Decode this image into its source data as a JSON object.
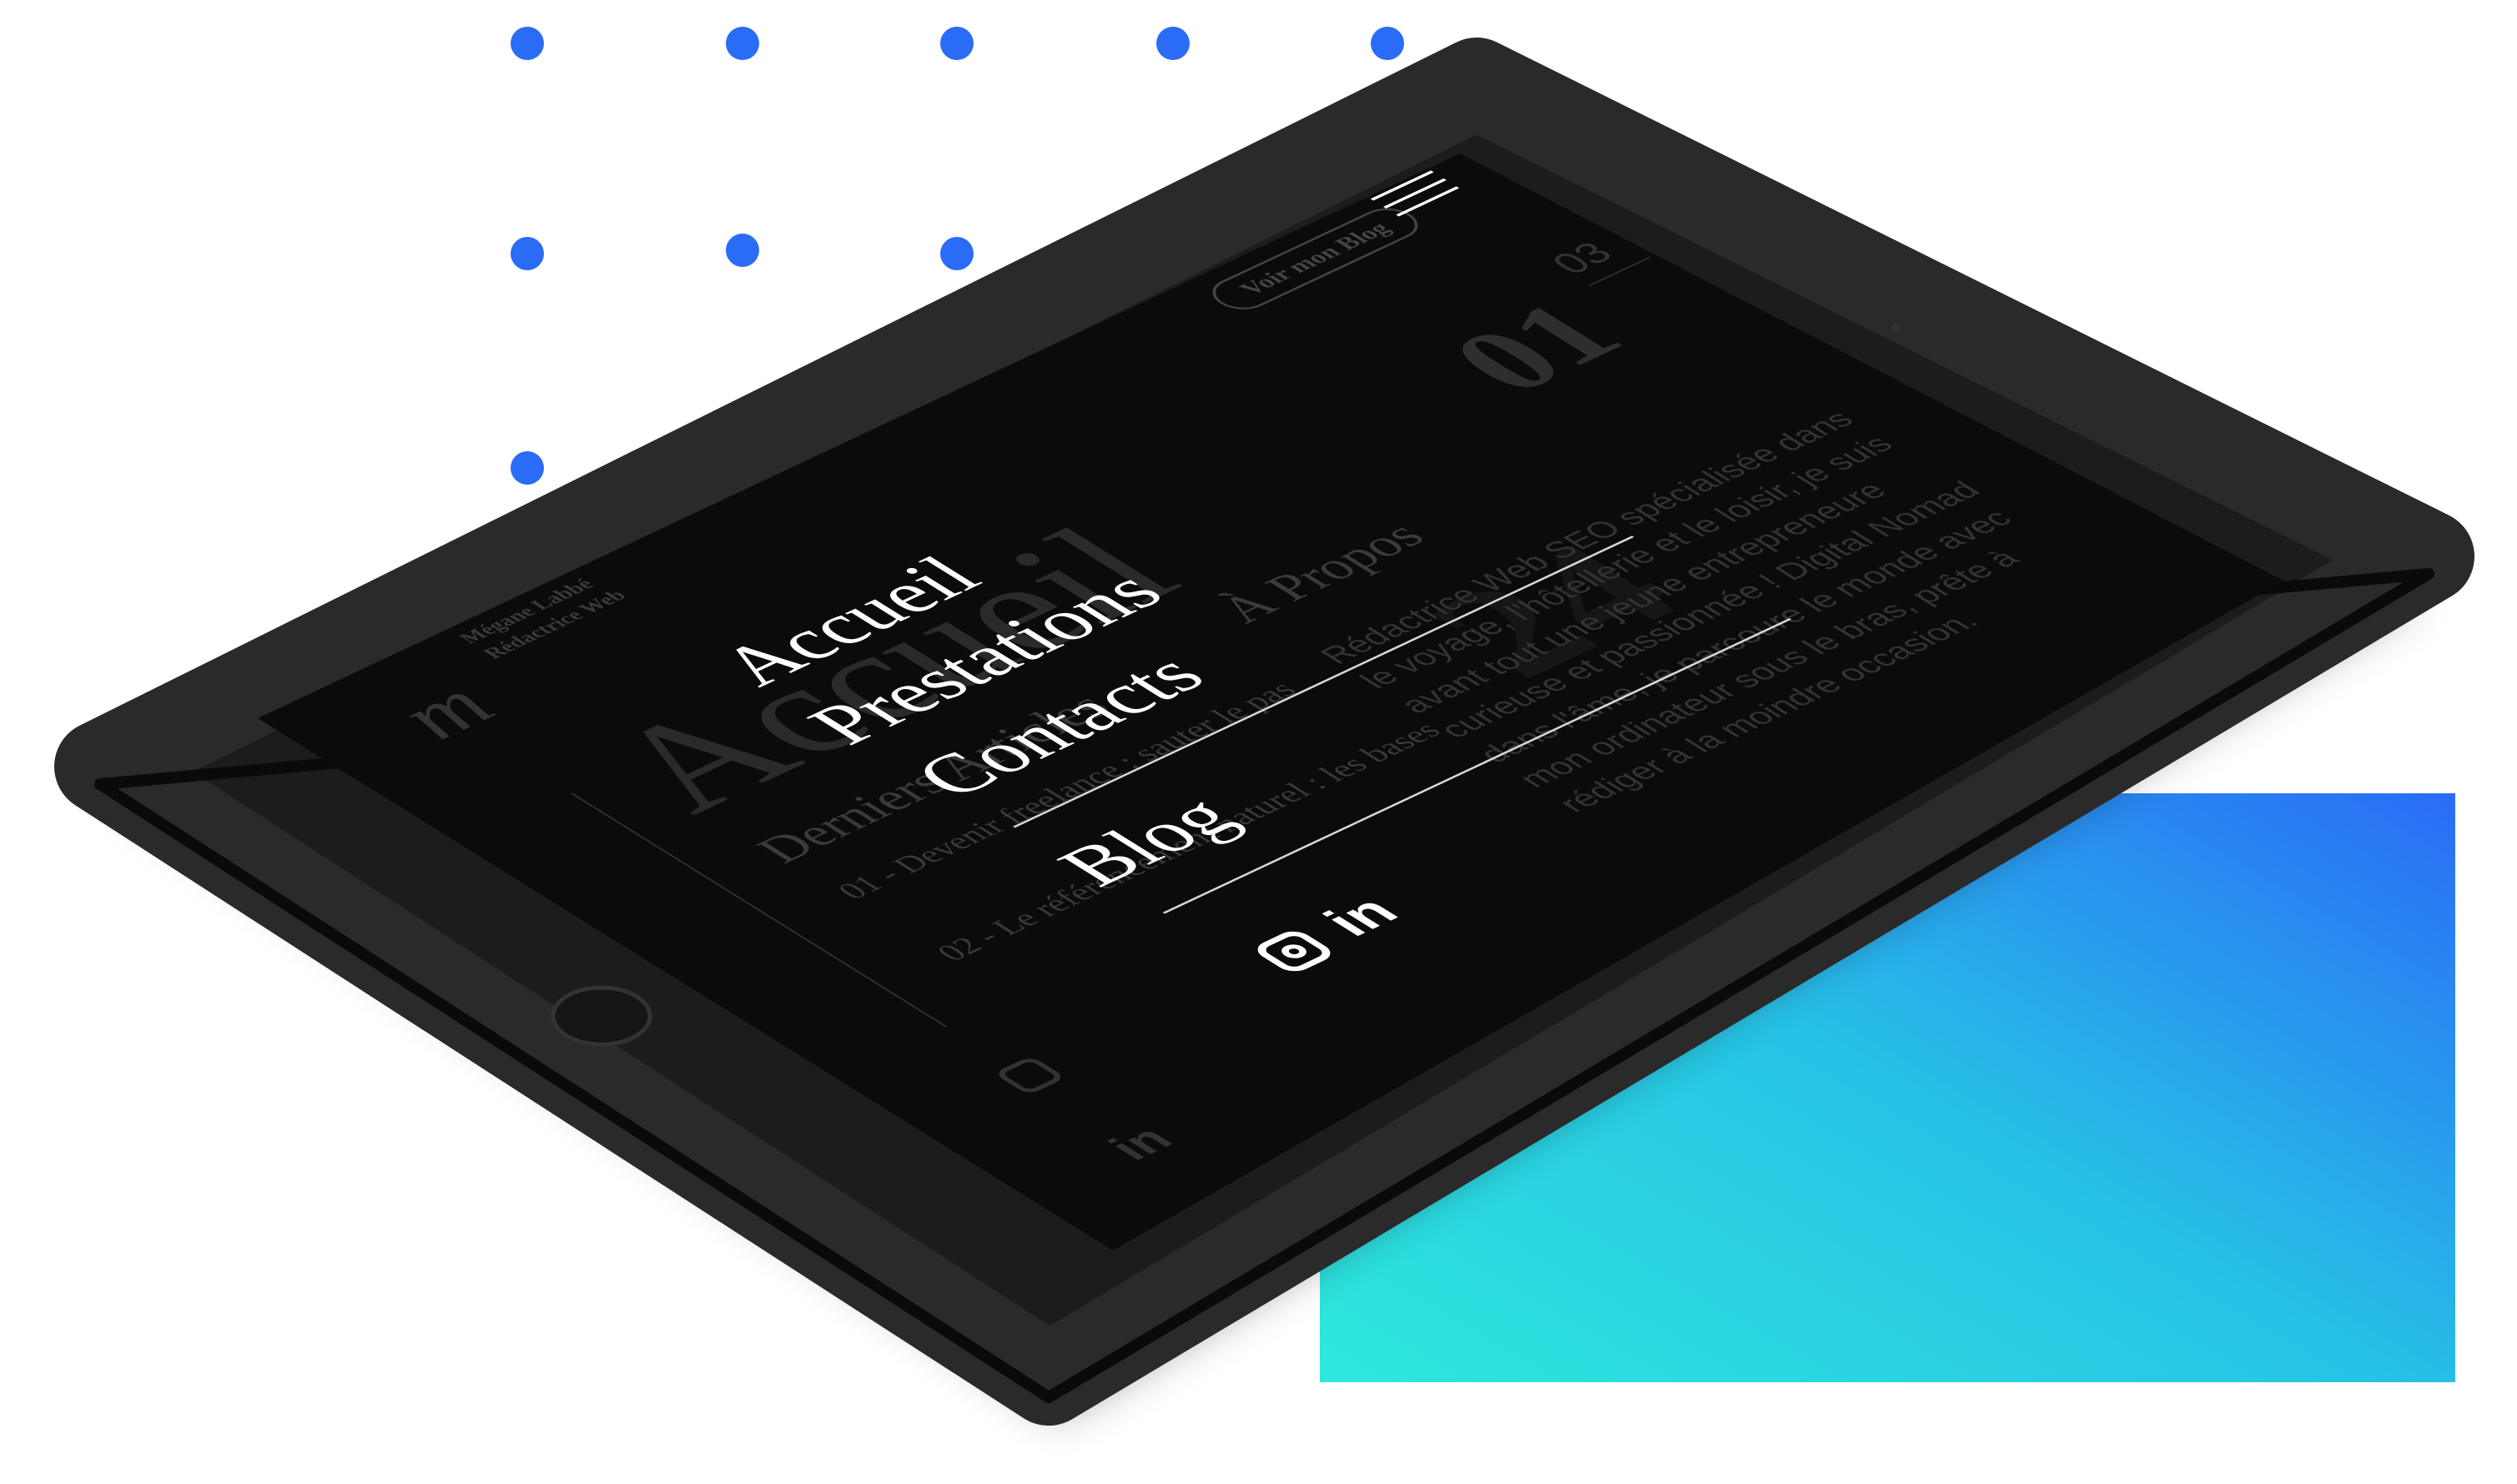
{
  "colors": {
    "accent_dots": "#2a6cf6",
    "gradient_start": "#2ee8dc",
    "gradient_end": "#2a6cf6",
    "tablet_body": "#1a1a1a",
    "screen_bg": "#0b0b0b"
  },
  "site": {
    "brand_name": "Mégane Labbé",
    "brand_tagline": "Rédactrice Web",
    "blog_button": "Voir mon Blog",
    "slide_current": "01",
    "slide_total": "03",
    "hero_title": "Accueil",
    "articles_heading": "Derniers Articles",
    "articles": [
      "01 - Devenir freelance : sauter le pas",
      "02 - Le référencement naturel : les bases"
    ],
    "about_heading": "À Propos",
    "about_text": "Rédactrice Web SEO spécialisée dans le voyage, l'hôtellerie et le loisir, je suis avant tout une jeune entrepreneure curieuse et passionnée ! Digital Nomad dans l'âme, je parcoure le monde avec mon ordinateur sous le bras, prête à rédiger à la moindre occasion.",
    "background_number": "24"
  },
  "menu": {
    "items": [
      {
        "label": "Accueil"
      },
      {
        "label": "Prestations"
      },
      {
        "label": "Contacts"
      },
      {
        "label": "Blog"
      }
    ]
  },
  "social": {
    "instagram_icon": "instagram-icon",
    "linkedin_label": "in"
  }
}
